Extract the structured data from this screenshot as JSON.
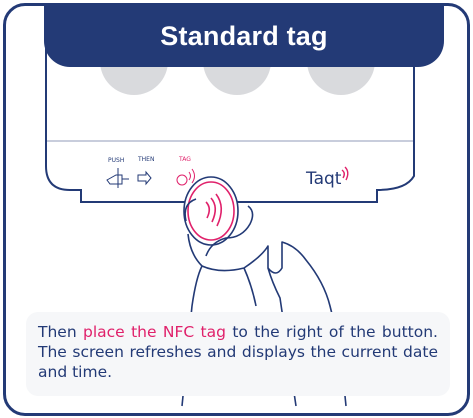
{
  "header": {
    "title": "Standard tag"
  },
  "device": {
    "push_label": "PUSH",
    "then_label": "THEN",
    "tag_label": "TAG",
    "brand": "Taqt",
    "icons": [
      "hand-press-icon",
      "arrow-right-icon",
      "nfc-tag-icon",
      "wifi-signal-icon"
    ]
  },
  "caption": {
    "before": "Then ",
    "highlight": "place the NFC tag",
    "after": " to the right of the button. The screen refreshes and displays the current date and time."
  },
  "colors": {
    "primary": "#233a76",
    "accent": "#e0216b",
    "text_box_bg": "#f6f7f9"
  }
}
